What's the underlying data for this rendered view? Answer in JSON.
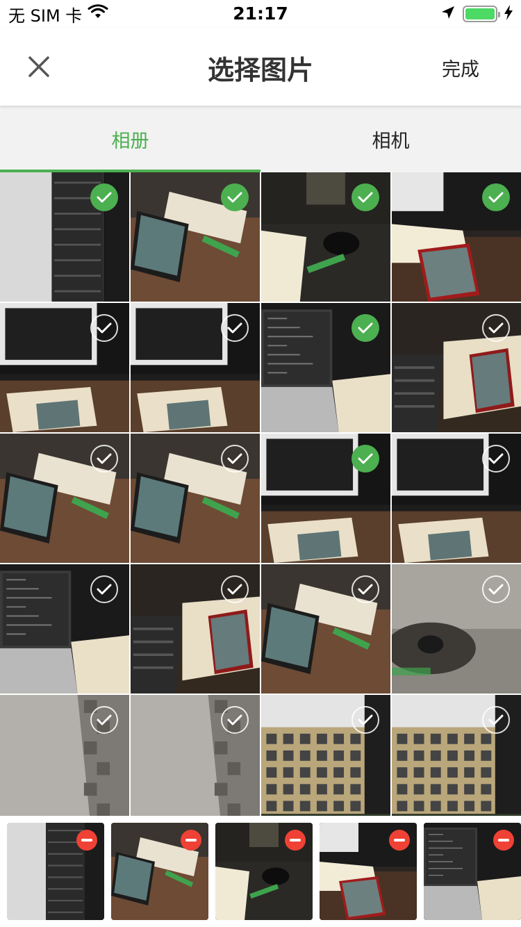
{
  "status_bar": {
    "carrier": "无 SIM 卡",
    "time": "21:17",
    "battery_level": 1.0
  },
  "nav": {
    "title": "选择图片",
    "done_label": "完成",
    "close_icon": "close-icon"
  },
  "tabs": [
    {
      "label": "相册",
      "active": true
    },
    {
      "label": "相机",
      "active": false
    }
  ],
  "colors": {
    "accent": "#4caf50",
    "remove": "#ef4135",
    "battery": "#4cd964"
  },
  "photos": [
    {
      "scene": "laptop-keyboard",
      "selected": true
    },
    {
      "scene": "desk-phone",
      "selected": true
    },
    {
      "scene": "desk-mouse",
      "selected": true
    },
    {
      "scene": "desk-phone-red",
      "selected": true
    },
    {
      "scene": "monitor-desk",
      "selected": false
    },
    {
      "scene": "monitor-desk",
      "selected": false
    },
    {
      "scene": "laptop-screen",
      "selected": true
    },
    {
      "scene": "laptop-phone",
      "selected": false
    },
    {
      "scene": "desk-phone",
      "selected": false
    },
    {
      "scene": "desk-phone",
      "selected": false
    },
    {
      "scene": "monitor-desk",
      "selected": true
    },
    {
      "scene": "monitor-desk",
      "selected": false
    },
    {
      "scene": "laptop-screen",
      "selected": false
    },
    {
      "scene": "laptop-phone",
      "selected": false
    },
    {
      "scene": "desk-phone",
      "selected": false
    },
    {
      "scene": "blurry-mouse",
      "selected": false
    },
    {
      "scene": "wall-curtain",
      "selected": false
    },
    {
      "scene": "wall-curtain",
      "selected": false
    },
    {
      "scene": "building",
      "selected": false
    },
    {
      "scene": "building",
      "selected": false
    }
  ],
  "selected_strip": [
    {
      "scene": "laptop-keyboard"
    },
    {
      "scene": "desk-phone"
    },
    {
      "scene": "desk-mouse"
    },
    {
      "scene": "desk-phone-red"
    },
    {
      "scene": "laptop-screen"
    }
  ]
}
